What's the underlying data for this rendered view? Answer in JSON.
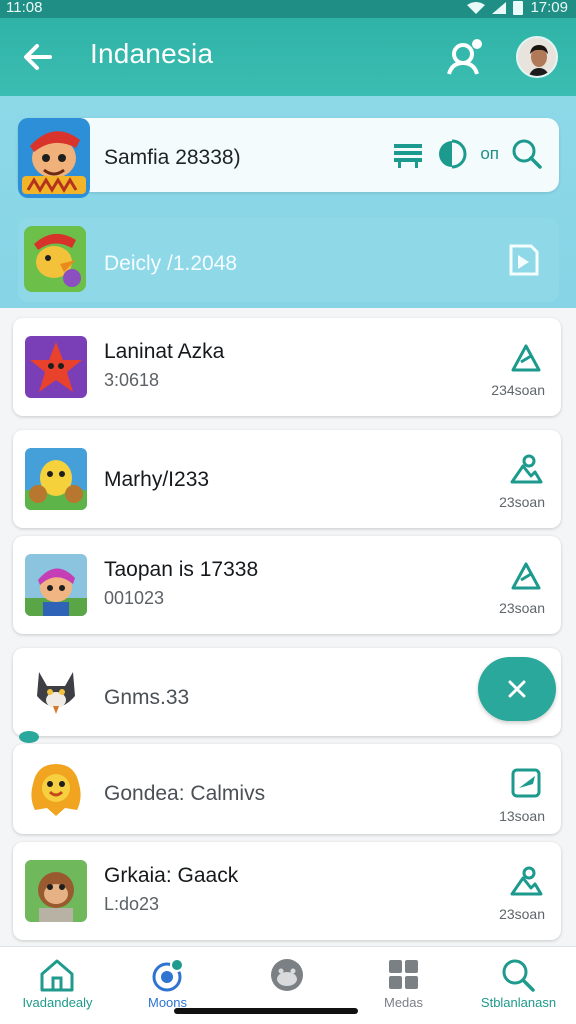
{
  "status_bar": {
    "time_left": "11:08",
    "time_right": "17:09"
  },
  "app_bar": {
    "title": "Indanesia"
  },
  "search_card": {
    "text": "Samfia 28338)",
    "label": "оп"
  },
  "feature_row": {
    "text": "Deicly /1.2048"
  },
  "list": [
    {
      "title": "Laninat Azka",
      "subtitle": "3:0618",
      "meta": "234soan",
      "icon": "alert-triangle-icon",
      "thumb_color": "#7a3fb6"
    },
    {
      "title": "Marhy/I233",
      "subtitle": "",
      "meta": "23soan",
      "icon": "mountain-user-icon",
      "thumb_color": "#45a0d9"
    },
    {
      "title": "Taopan is 17338",
      "subtitle": "001023",
      "meta": "23soan",
      "icon": "alert-triangle-icon",
      "thumb_color": "#8bc4df"
    },
    {
      "title": "Gnms.33",
      "subtitle": "",
      "meta": "",
      "icon": "",
      "thumb_color": "#ffffff"
    },
    {
      "title": "Gondea: Calmivs",
      "subtitle": "",
      "meta": "13soan",
      "icon": "edit-icon",
      "thumb_color": "#ffffff"
    },
    {
      "title": "Grkaia: Gaack",
      "subtitle": "L:do23",
      "meta": "23soan",
      "icon": "mountain-user-icon",
      "thumb_color": "#6fb85c"
    }
  ],
  "bottom_nav": [
    {
      "label": "Ivadandealy",
      "icon": "home-icon",
      "color": "#1f9a8c"
    },
    {
      "label": "Moons",
      "icon": "target-icon",
      "color": "#2f74d0"
    },
    {
      "label": "",
      "icon": "face-icon",
      "color": "#7b8085"
    },
    {
      "label": "Medas",
      "icon": "grid-icon",
      "color": "#7b8085"
    },
    {
      "label": "Stblanlanasn",
      "icon": "search-icon",
      "color": "#1f9a8c"
    }
  ],
  "colors": {
    "accent": "#2fb3a7",
    "hero": "#8ed9e8",
    "fab": "#2aa89b"
  }
}
